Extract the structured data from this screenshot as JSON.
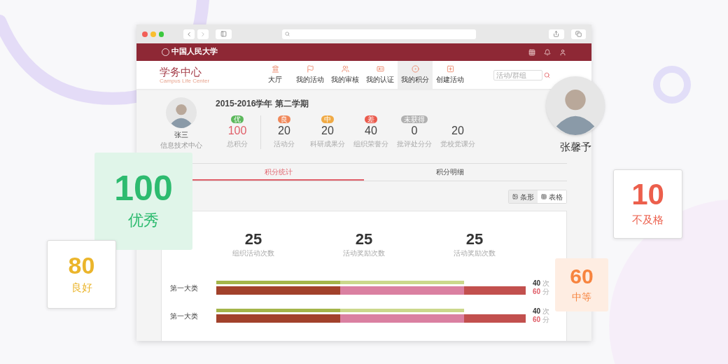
{
  "header": {
    "logo": "中国人民大学"
  },
  "brand": {
    "title": "学务中心",
    "subtitle": "Campus Life Center"
  },
  "nav": [
    {
      "label": "大厅",
      "selected": false
    },
    {
      "label": "我的活动",
      "selected": false
    },
    {
      "label": "我的审核",
      "selected": false
    },
    {
      "label": "我的认证",
      "selected": false
    },
    {
      "label": "我的积分",
      "selected": true
    },
    {
      "label": "创建活动",
      "selected": false
    }
  ],
  "search": {
    "placeholder": "活动/群组"
  },
  "profile": {
    "name": "张三",
    "department": "信息技术中心"
  },
  "term": "2015-2016学年 第二学期",
  "scores": [
    {
      "kind": "total",
      "badge": "优",
      "color": "#5cb85c",
      "value": "100",
      "label": "总积分"
    },
    {
      "kind": "part",
      "badge": "良",
      "color": "#f0885a",
      "value": "20",
      "label": "活动分"
    },
    {
      "kind": "part",
      "badge": "中",
      "color": "#f0aa45",
      "value": "20",
      "label": "科研成果分"
    },
    {
      "kind": "part",
      "badge": "差",
      "color": "#ea5a4c",
      "value": "40",
      "label": "组织荣誉分"
    },
    {
      "kind": "part",
      "badge": "未获得",
      "color": "#b0b0b0",
      "value": "0",
      "label": "批评处分分"
    },
    {
      "kind": "part",
      "value": "20",
      "label": "党校党课分"
    }
  ],
  "tabs": [
    {
      "label": "积分统计",
      "selected": true
    },
    {
      "label": "积分明细",
      "selected": false
    }
  ],
  "view_toggle": [
    {
      "label": "条形",
      "selected": true
    },
    {
      "label": "表格",
      "selected": false
    }
  ],
  "stats": [
    {
      "value": "25",
      "label": "组织活动次数"
    },
    {
      "value": "25",
      "label": "活动奖励次数"
    },
    {
      "value": "25",
      "label": "活动奖励次数"
    }
  ],
  "rows": [
    {
      "label": "第一大类",
      "count": "40",
      "count_unit": "次",
      "points": "60",
      "points_unit": "分"
    },
    {
      "label": "第一大类",
      "count": "40",
      "count_unit": "次",
      "points": "60",
      "points_unit": "分"
    }
  ],
  "featured_user": {
    "name": "张馨予"
  },
  "cards": [
    {
      "kind": "tinted",
      "value": "100",
      "label": "优秀",
      "color": "#2dbb6f"
    },
    {
      "kind": "plain",
      "value": "80",
      "label": "良好",
      "color": "#ebb52b"
    },
    {
      "kind": "plain",
      "value": "10",
      "label": "不及格",
      "color": "#ec5f4c"
    },
    {
      "kind": "tinted",
      "value": "60",
      "label": "中等",
      "color": "#f7843f"
    }
  ]
}
